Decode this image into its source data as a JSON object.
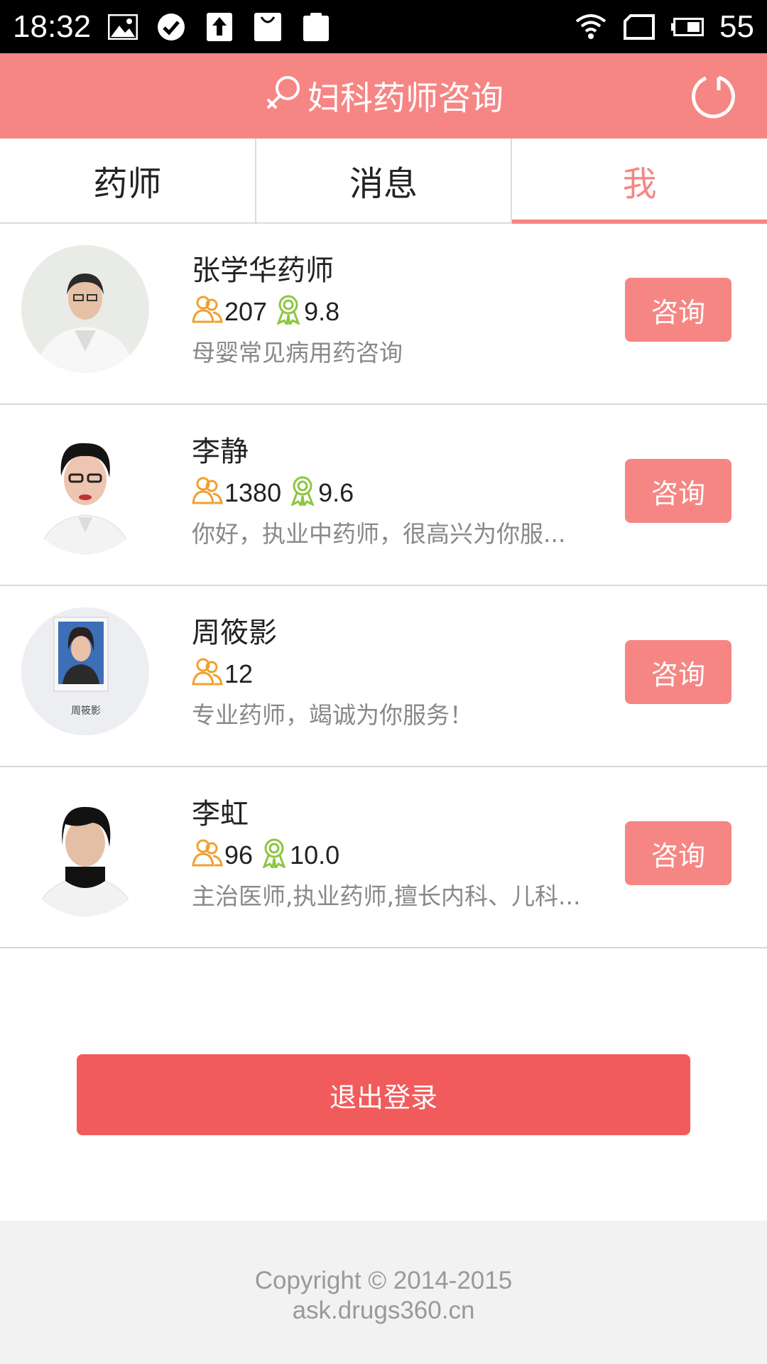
{
  "status_bar": {
    "time": "18:32",
    "battery": "55",
    "icons": [
      "image-icon",
      "check-circle-icon",
      "upload-icon",
      "bag-icon",
      "clipboard-icon",
      "wifi-icon",
      "sim-icon",
      "battery-icon"
    ]
  },
  "header": {
    "title": "妇科药师咨询",
    "title_icon": "female-symbol-icon",
    "refresh_icon": "refresh-icon",
    "color": "#F58684"
  },
  "tabs": [
    {
      "label": "药师",
      "active": false
    },
    {
      "label": "消息",
      "active": false
    },
    {
      "label": "我",
      "active": true
    }
  ],
  "pharmacists": [
    {
      "name": "张学华药师",
      "consults": "207",
      "rating": "9.8",
      "desc": "母婴常见病用药咨询",
      "button": "咨询"
    },
    {
      "name": "李静",
      "consults": "1380",
      "rating": "9.6",
      "desc": "你好，执业中药师，很高兴为你服...",
      "button": "咨询"
    },
    {
      "name": "周筱影",
      "consults": "12",
      "rating": null,
      "desc": "专业药师，竭诚为你服务！",
      "button": "咨询"
    },
    {
      "name": "李虹",
      "consults": "96",
      "rating": "10.0",
      "desc": "主治医师,执业药师,擅长内科、儿科...",
      "button": "咨询"
    }
  ],
  "logout": {
    "label": "退出登录",
    "color": "#F25B5B"
  },
  "footer": {
    "copyright": "Copyright © 2014-2015",
    "site": "ask.drugs360.cn"
  }
}
